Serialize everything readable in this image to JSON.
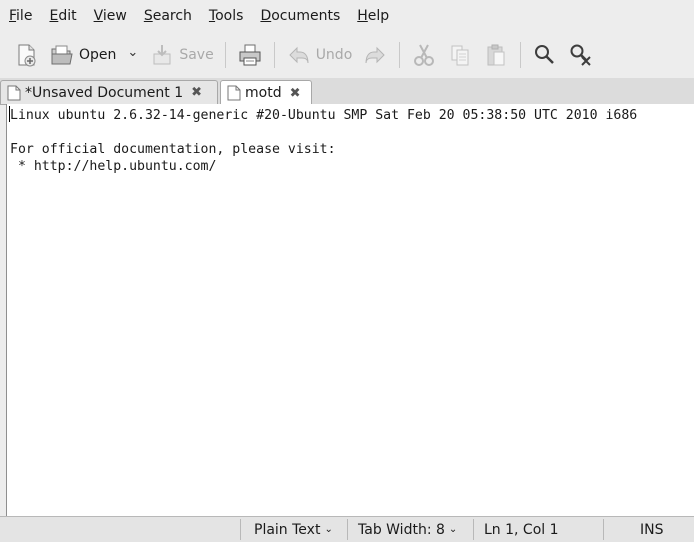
{
  "menubar": {
    "items": [
      {
        "label": "File",
        "mnemonic": "F",
        "rest": "ile"
      },
      {
        "label": "Edit",
        "mnemonic": "E",
        "rest": "dit"
      },
      {
        "label": "View",
        "mnemonic": "V",
        "rest": "iew"
      },
      {
        "label": "Search",
        "mnemonic": "S",
        "rest": "earch"
      },
      {
        "label": "Tools",
        "mnemonic": "T",
        "rest": "ools"
      },
      {
        "label": "Documents",
        "mnemonic": "D",
        "rest": "ocuments"
      },
      {
        "label": "Help",
        "mnemonic": "H",
        "rest": "elp"
      }
    ]
  },
  "toolbar": {
    "new_icon": "new-document-icon",
    "open_label": "Open",
    "open_icon": "folder-open-icon",
    "dropdown_glyph": "⌄",
    "save_label": "Save",
    "save_icon": "save-icon",
    "print_icon": "printer-icon",
    "undo_label": "Undo",
    "undo_icon": "undo-icon",
    "redo_icon": "redo-icon",
    "cut_icon": "scissors-icon",
    "copy_icon": "copy-icon",
    "paste_icon": "paste-icon",
    "find_icon": "search-icon",
    "replace_icon": "find-replace-icon"
  },
  "tabs": [
    {
      "label": "*Unsaved Document 1",
      "icon": "document-icon",
      "close": "✖",
      "active": false
    },
    {
      "label": "motd",
      "icon": "document-icon",
      "close": "✖",
      "active": true
    }
  ],
  "editor": {
    "content": "Linux ubuntu 2.6.32-14-generic #20-Ubuntu SMP Sat Feb 20 05:38:50 UTC 2010 i686\n\nFor official documentation, please visit:\n * http://help.ubuntu.com/"
  },
  "statusbar": {
    "syntax": "Plain Text",
    "tab_width": "Tab Width: 8",
    "position": "Ln 1, Col 1",
    "mode": "INS",
    "dropdown_glyph": "⌄"
  },
  "colors": {
    "chrome_bg": "#ededed",
    "editor_bg": "#ffffff",
    "disabled_text": "#a9a9a9"
  }
}
